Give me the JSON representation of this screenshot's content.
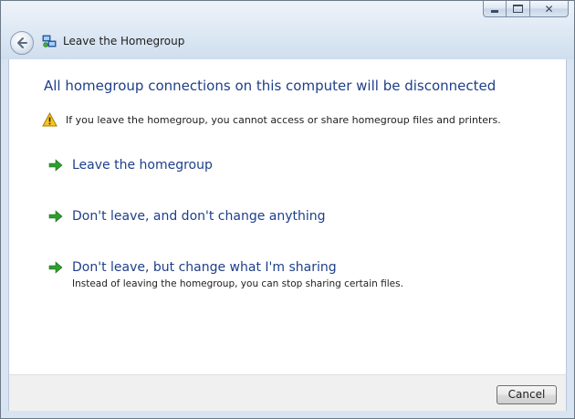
{
  "window": {
    "caption_buttons": [
      "minimize",
      "maximize",
      "close"
    ]
  },
  "nav": {
    "back_icon": "back-arrow-icon",
    "app_icon": "homegroup-icon",
    "title": "Leave the Homegroup"
  },
  "main": {
    "headline": "All homegroup connections on this computer will be disconnected",
    "warning": {
      "icon": "warning-icon",
      "text": "If you leave the homegroup, you cannot access or share homegroup files and printers."
    },
    "commands": [
      {
        "label": "Leave the homegroup",
        "note": ""
      },
      {
        "label": "Don't leave, and don't change anything",
        "note": ""
      },
      {
        "label": "Don't leave, but change what I'm sharing",
        "note": "Instead of leaving the homegroup, you can stop sharing certain files."
      }
    ]
  },
  "footer": {
    "cancel_label": "Cancel"
  },
  "colors": {
    "heading_blue": "#1e3f8a",
    "link_arrow_green": "#2e9e2e",
    "frame_blue": "#d8e4f1"
  }
}
